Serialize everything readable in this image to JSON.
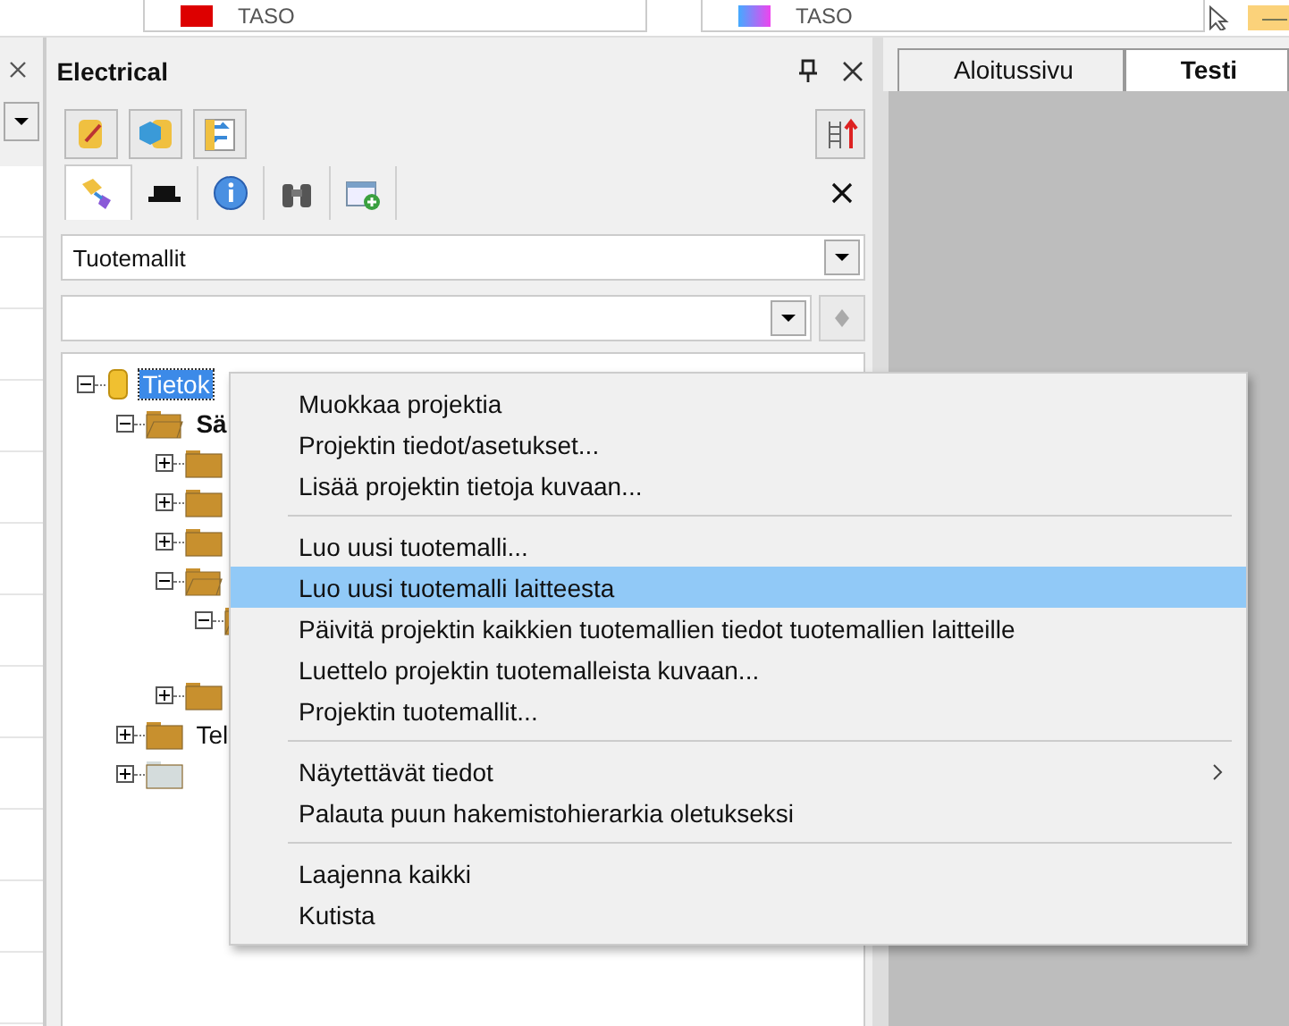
{
  "top_toolbar": {
    "fields": [
      "TASO",
      "TASO"
    ]
  },
  "panel": {
    "title": "Electrical",
    "tool_tabs": [
      {
        "kind": "tree",
        "selected": true
      },
      {
        "kind": "block",
        "selected": false
      },
      {
        "kind": "info",
        "selected": false
      },
      {
        "kind": "binoculars",
        "selected": false
      },
      {
        "kind": "new-folder",
        "selected": false
      }
    ],
    "filter": {
      "value": "Tuotemallit"
    },
    "tree": [
      {
        "kind": "database",
        "label": "Tietok",
        "selected": true,
        "expanded": true,
        "children": [
          {
            "kind": "folder",
            "label": "Sä",
            "bold": true,
            "expanded": true,
            "children": [
              {
                "kind": "folder",
                "expanded": false
              },
              {
                "kind": "folder",
                "expanded": false
              },
              {
                "kind": "folder",
                "expanded": false
              },
              {
                "kind": "folder",
                "expanded": true,
                "children": [
                  {
                    "kind": "folder",
                    "expanded": true
                  }
                ]
              },
              {
                "kind": "folder",
                "expanded": false,
                "gap": true
              }
            ]
          },
          {
            "kind": "folder",
            "label": "Tel",
            "expanded": false
          },
          {
            "kind": "empty-folder",
            "expanded": false
          }
        ]
      }
    ]
  },
  "document_tabs": [
    {
      "label": "Aloitussivu",
      "selected": false
    },
    {
      "label": "Testi",
      "selected": true
    }
  ],
  "context_menu": [
    [
      {
        "label": "Muokkaa projektia",
        "selected": false,
        "submenu": false
      },
      {
        "label": "Projektin tiedot/asetukset...",
        "selected": false,
        "submenu": false
      },
      {
        "label": "Lisää projektin tietoja kuvaan...",
        "selected": false,
        "submenu": false
      }
    ],
    [
      {
        "label": "Luo uusi tuotemalli...",
        "selected": false,
        "submenu": false
      },
      {
        "label": "Luo uusi tuotemalli laitteesta",
        "selected": true,
        "submenu": false
      },
      {
        "label": "Päivitä projektin kaikkien tuotemallien tiedot tuotemallien laitteille",
        "selected": false,
        "submenu": false
      },
      {
        "label": "Luettelo projektin tuotemalleista kuvaan...",
        "selected": false,
        "submenu": false
      },
      {
        "label": "Projektin tuotemallit...",
        "selected": false,
        "submenu": false
      }
    ],
    [
      {
        "label": "Näytettävät tiedot",
        "selected": false,
        "submenu": true
      },
      {
        "label": "Palauta puun hakemistohierarkia oletukseksi",
        "selected": false,
        "submenu": false
      }
    ],
    [
      {
        "label": "Laajenna kaikki",
        "selected": false,
        "submenu": false
      },
      {
        "label": "Kutista",
        "selected": false,
        "submenu": false
      }
    ]
  ]
}
